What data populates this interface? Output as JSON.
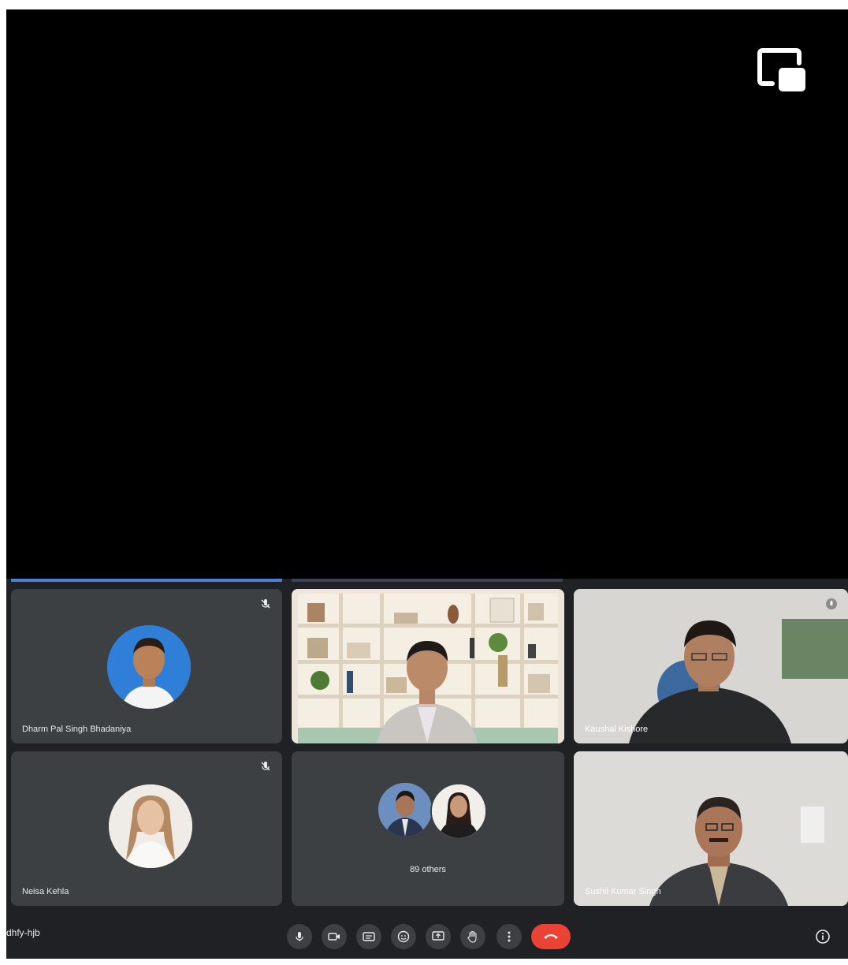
{
  "meeting": {
    "code_fragment": "dhfy-hjb",
    "others_label": "89 others"
  },
  "participants": [
    {
      "name": "Dharm Pal Singh Bhadaniya",
      "type": "avatar",
      "muted": true
    },
    {
      "name": "",
      "type": "video",
      "muted": true
    },
    {
      "name": "Kaushal Kishore",
      "type": "video",
      "muted": true
    },
    {
      "name": "Neisa Kehla",
      "type": "avatar",
      "muted": true
    },
    {
      "name": "89 others",
      "type": "group",
      "muted": false
    },
    {
      "name": "Sushil Kumar Singh",
      "type": "video",
      "muted": false
    }
  ],
  "toolbar": {
    "buttons": [
      "mic-icon",
      "camera-icon",
      "captions-icon",
      "emoji-icon",
      "present-icon",
      "raise-hand-icon",
      "more-options-icon"
    ],
    "end_call": "end-call-icon",
    "info": "info-icon"
  },
  "colors": {
    "background": "#000000",
    "tile": "#3c4043",
    "toolbar": "#202124",
    "end_call": "#ea4335",
    "accent": "#4a7fd4"
  }
}
